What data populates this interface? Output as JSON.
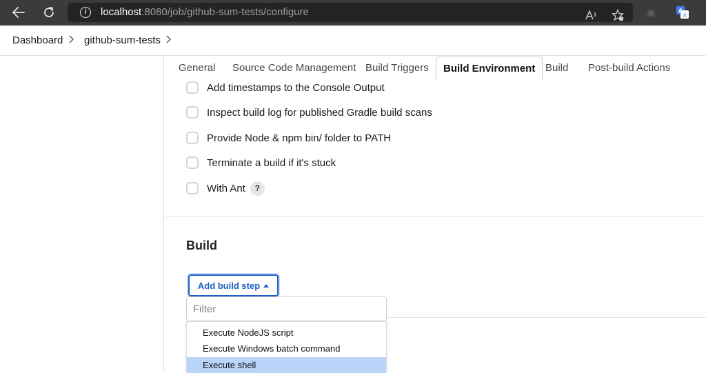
{
  "browser": {
    "url_host": "localhost",
    "url_rest": ":8080/job/github-sum-tests/configure"
  },
  "breadcrumb": {
    "items": [
      "Dashboard",
      "github-sum-tests"
    ],
    "separator": ">"
  },
  "tabs": [
    {
      "label": "General"
    },
    {
      "label": "Source Code Management"
    },
    {
      "label": "Build Triggers"
    },
    {
      "label": "Build Environment",
      "active": true
    },
    {
      "label": "Build"
    },
    {
      "label": "Post-build Actions"
    }
  ],
  "build_environment": {
    "options": [
      {
        "label": "Add timestamps to the Console Output",
        "checked": false
      },
      {
        "label": "Inspect build log for published Gradle build scans",
        "checked": false
      },
      {
        "label": "Provide Node & npm bin/ folder to PATH",
        "checked": false
      },
      {
        "label": "Terminate a build if it's stuck",
        "checked": false
      },
      {
        "label": "With Ant",
        "checked": false,
        "help": "?"
      }
    ]
  },
  "build": {
    "title": "Build",
    "add_step_label": "Add build step",
    "filter_placeholder": "Filter",
    "menu_items": [
      {
        "label": "Execute NodeJS script"
      },
      {
        "label": "Execute Windows batch command"
      },
      {
        "label": "Execute shell",
        "highlighted": true
      }
    ]
  },
  "colors": {
    "chrome_bg": "#3b3b3b",
    "accent": "#1e5fc4",
    "highlight": "#b8d4f8"
  }
}
